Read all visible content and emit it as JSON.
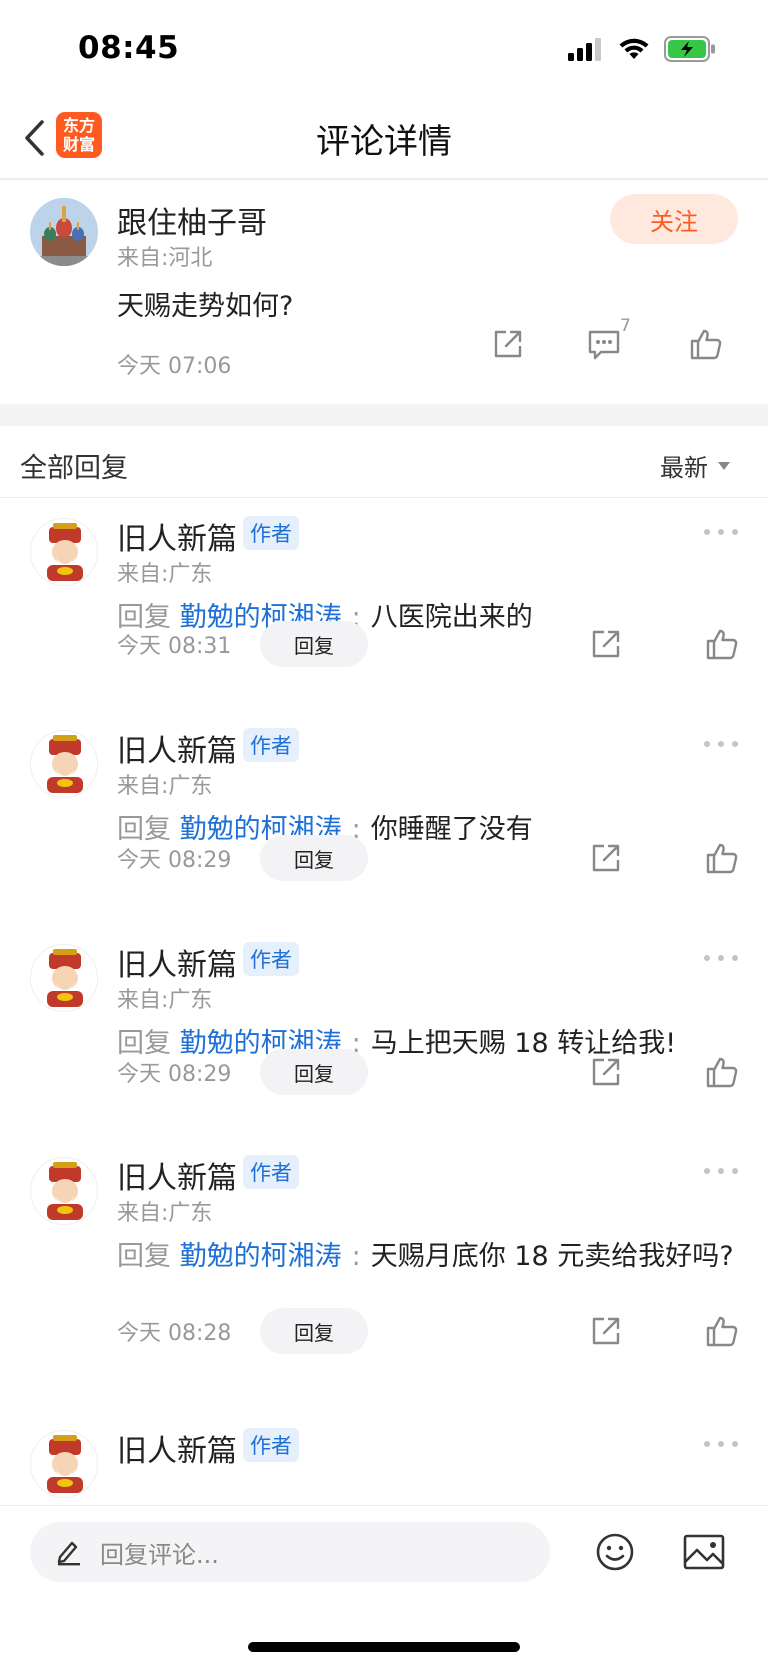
{
  "status_bar": {
    "time": "08:45"
  },
  "nav": {
    "title": "评论详情",
    "logo_line1": "东方",
    "logo_line2": "财富"
  },
  "post": {
    "author": "跟住柚子哥",
    "from": "来自:河北",
    "follow_label": "关注",
    "content": "天赐走势如何?",
    "time": "今天 07:06",
    "comment_count": "7"
  },
  "replies_header": {
    "title": "全部回复",
    "sort_label": "最新"
  },
  "replies": [
    {
      "author": "旧人新篇",
      "badge": "作者",
      "from": "来自:广东",
      "prefix": "回复",
      "target": "勤勉的柯湘涛",
      "sep": ":",
      "text": "八医院出来的",
      "time": "今天 08:31",
      "reply_label": "回复"
    },
    {
      "author": "旧人新篇",
      "badge": "作者",
      "from": "来自:广东",
      "prefix": "回复",
      "target": "勤勉的柯湘涛",
      "sep": ":",
      "text": "你睡醒了没有",
      "time": "今天 08:29",
      "reply_label": "回复"
    },
    {
      "author": "旧人新篇",
      "badge": "作者",
      "from": "来自:广东",
      "prefix": "回复",
      "target": "勤勉的柯湘涛",
      "sep": ":",
      "text": "马上把天赐 18 转让给我!",
      "time": "今天 08:29",
      "reply_label": "回复"
    },
    {
      "author": "旧人新篇",
      "badge": "作者",
      "from": "来自:广东",
      "prefix": "回复",
      "target": "勤勉的柯湘涛",
      "sep": ":",
      "text": "天赐月底你 18 元卖给我好吗?",
      "time": "今天 08:28",
      "reply_label": "回复"
    },
    {
      "author": "旧人新篇",
      "badge": "作者"
    }
  ],
  "bottom_bar": {
    "input_placeholder": "回复评论..."
  },
  "icons": {
    "back": "chevron-left-icon",
    "share": "share-icon",
    "comment": "comment-icon",
    "like": "thumbs-up-icon",
    "more": "more-icon",
    "edit": "pencil-icon",
    "emoji": "emoji-icon",
    "image": "image-icon"
  },
  "colors": {
    "accent": "#ff5a1f",
    "link": "#1e70d6",
    "muted": "#999999"
  }
}
